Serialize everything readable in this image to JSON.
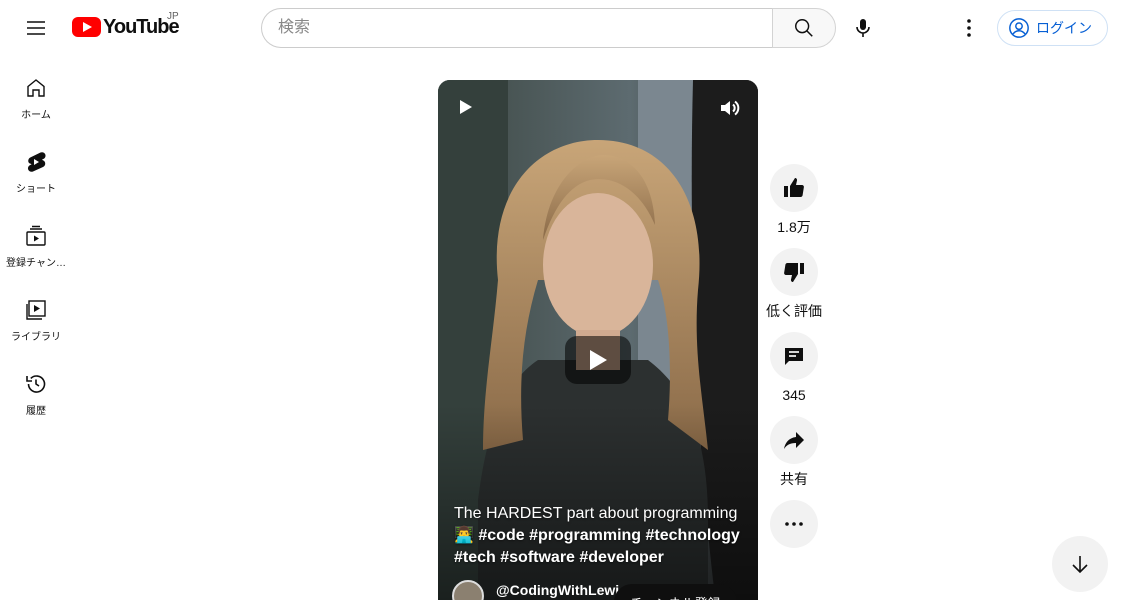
{
  "header": {
    "logo_text": "YouTube",
    "region": "JP",
    "search_placeholder": "検索",
    "login_label": "ログイン"
  },
  "nav": {
    "items": [
      {
        "label": "ホーム",
        "icon": "home-icon"
      },
      {
        "label": "ショート",
        "icon": "shorts-icon"
      },
      {
        "label": "登録チャン…",
        "icon": "subscriptions-icon"
      },
      {
        "label": "ライブラリ",
        "icon": "library-icon"
      },
      {
        "label": "履歴",
        "icon": "history-icon"
      }
    ]
  },
  "video": {
    "caption_title": "The HARDEST part about programming ",
    "caption_emoji": "👨‍💻",
    "caption_tags": "#code #programming #technology #tech #software #developer",
    "channel": "@CodingWithLewi",
    "subscribe_label": "チャンネル登録"
  },
  "actions": {
    "like_count": "1.8万",
    "dislike_label": "低く評価",
    "comment_count": "345",
    "share_label": "共有"
  },
  "colors": {
    "brand_red": "#ff0000",
    "link_blue": "#065fd4",
    "button_gray": "#f2f2f2"
  }
}
